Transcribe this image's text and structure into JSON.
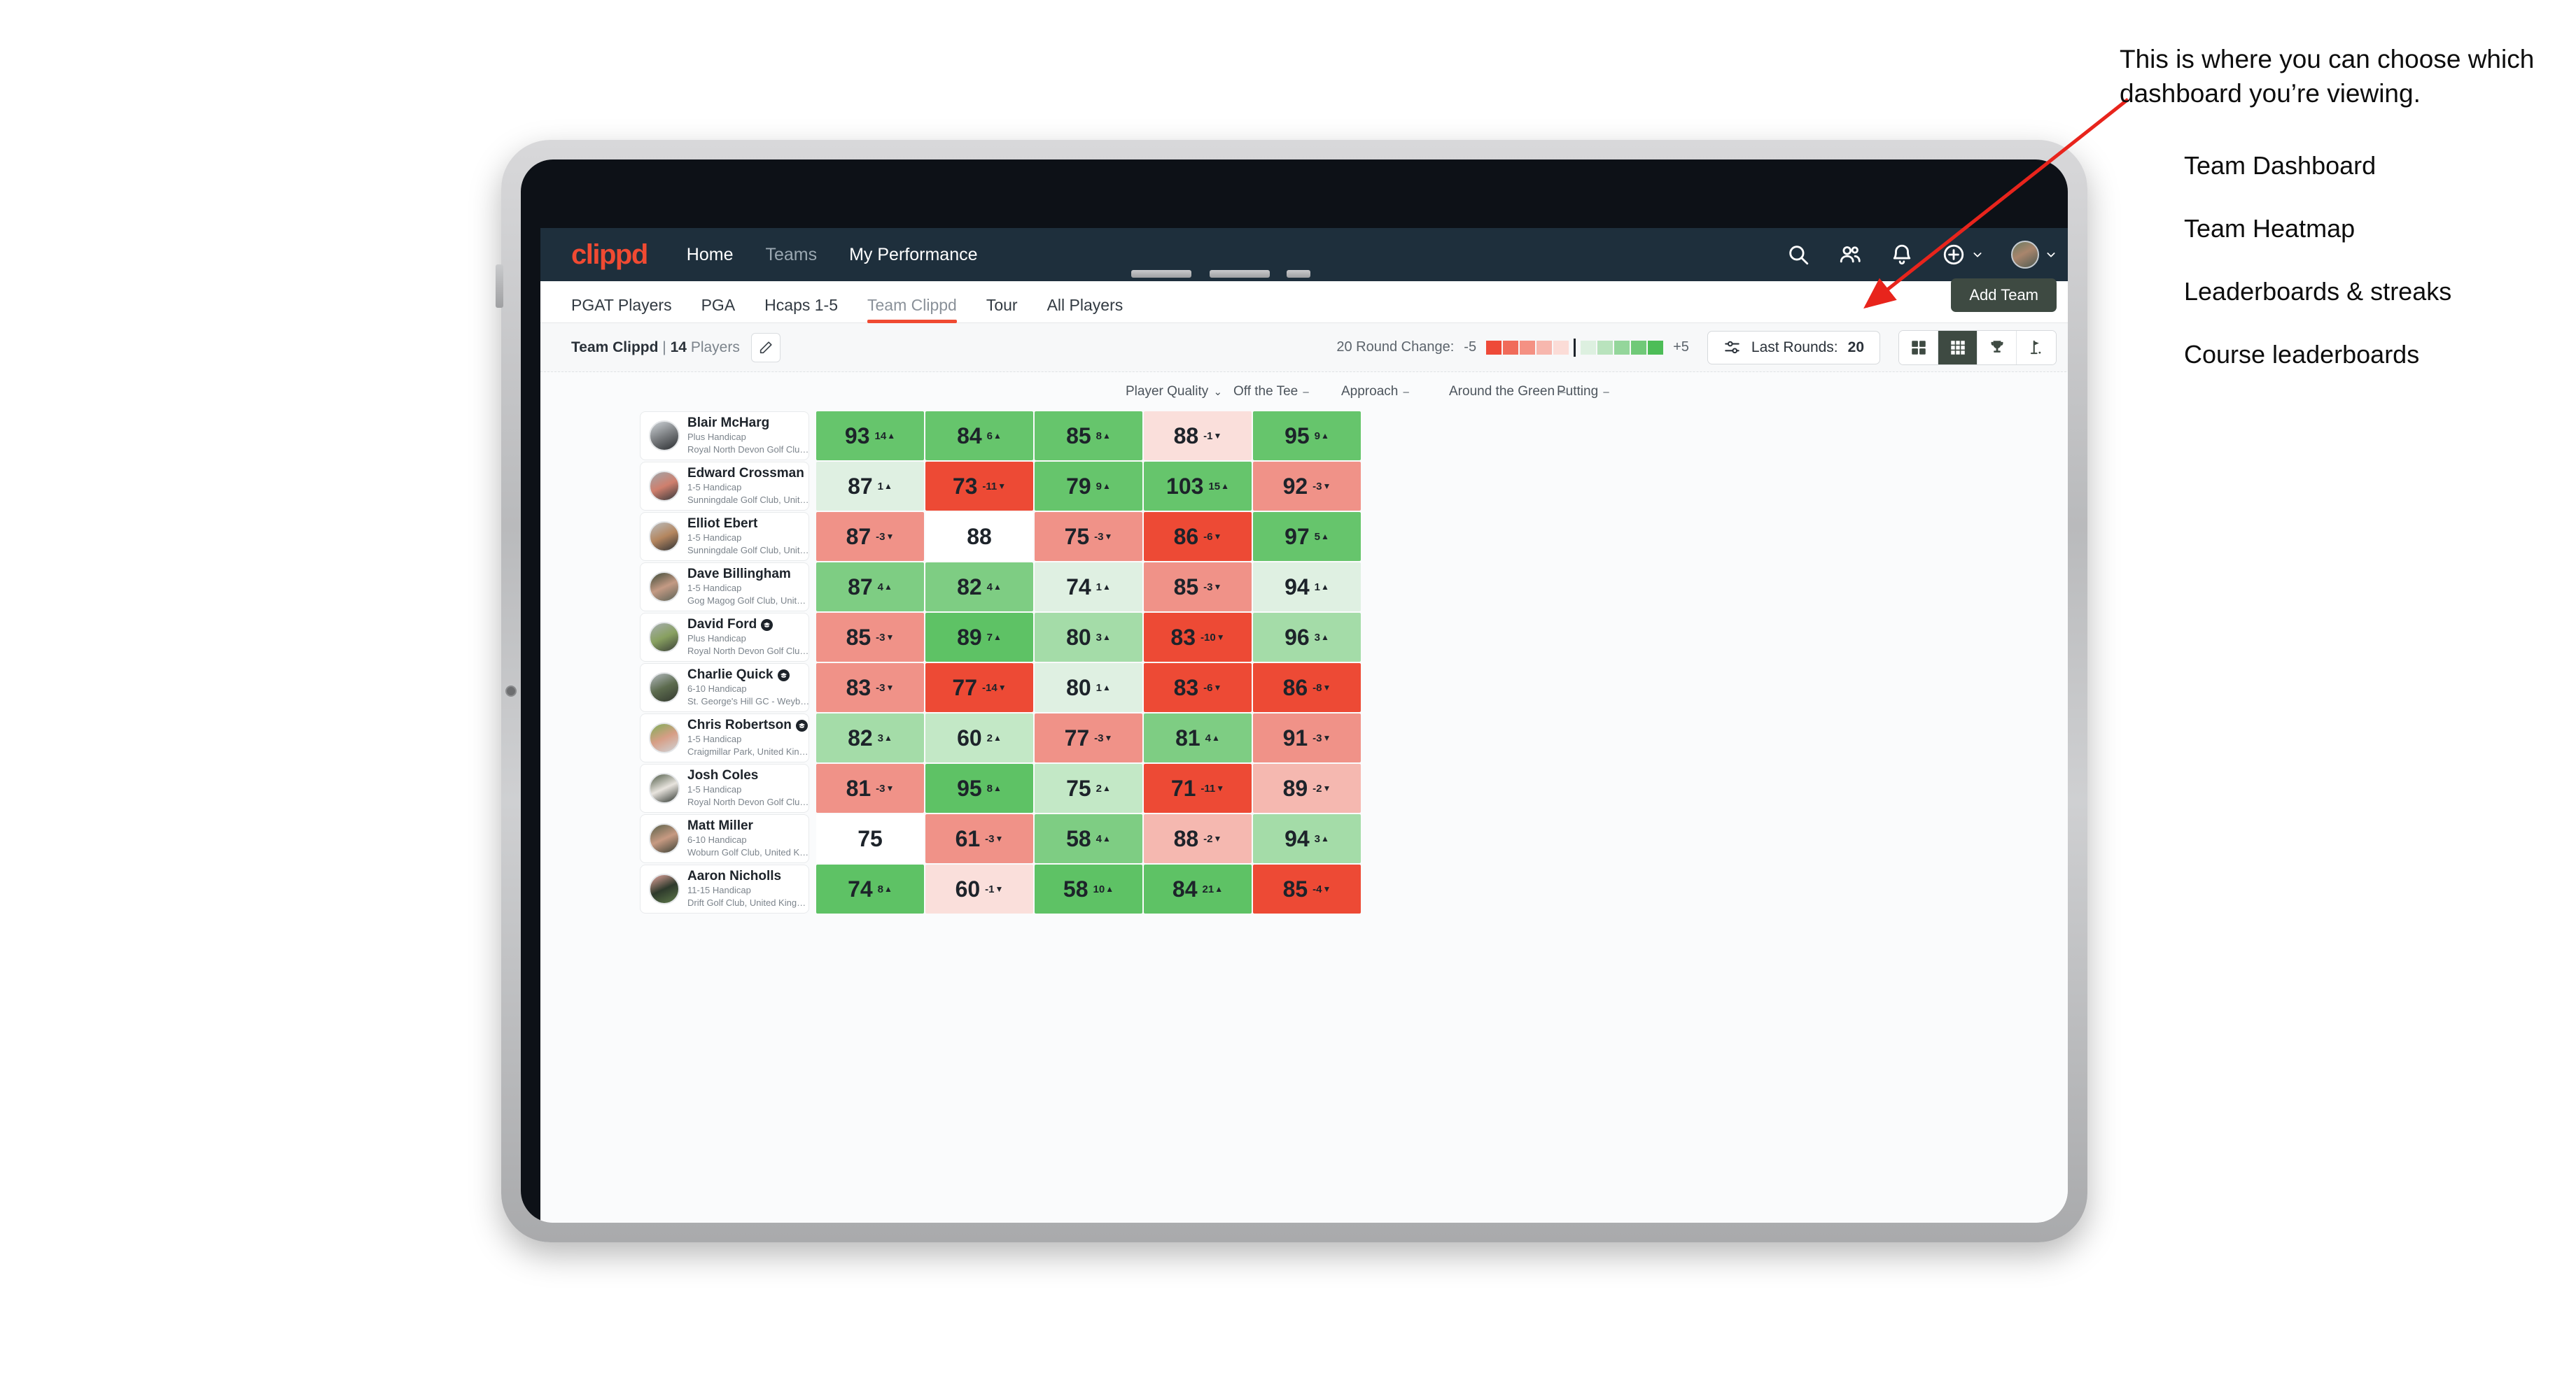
{
  "brand": {
    "logo_text": "clippd",
    "accent": "#f04a32",
    "navbar_bg": "#1e2f3c"
  },
  "topnav": {
    "links": [
      {
        "label": "Home",
        "dim": false
      },
      {
        "label": "Teams",
        "dim": true
      },
      {
        "label": "My Performance",
        "dim": false
      }
    ],
    "icons": [
      "search-icon",
      "people-icon",
      "bell-icon",
      "plus-circle-icon",
      "avatar"
    ]
  },
  "subtabs": {
    "items": [
      {
        "label": "PGAT Players",
        "active": false
      },
      {
        "label": "PGA",
        "active": false
      },
      {
        "label": "Hcaps 1-5",
        "active": false
      },
      {
        "label": "Team Clippd",
        "active": true
      },
      {
        "label": "Tour",
        "active": false
      },
      {
        "label": "All Players",
        "active": false
      }
    ],
    "add_team_label": "Add Team"
  },
  "toolbar": {
    "team_name": "Team Clippd",
    "separator": "|",
    "player_count": "14",
    "players_word": "Players",
    "edit_icon": "pencil-icon",
    "round_change_label": "20 Round Change:",
    "scale_min": "-5",
    "scale_max": "+5",
    "scale_colors": [
      "#ee4a38",
      "#f06b5a",
      "#f49183",
      "#f7b7ae",
      "#fbdcd7",
      "#ddf0e0",
      "#b9e3bd",
      "#94d69b",
      "#70c978",
      "#4dbd57"
    ],
    "last_rounds_label": "Last Rounds:",
    "last_rounds_value": "20",
    "views": [
      {
        "icon": "grid-4-icon",
        "name": "Team Dashboard",
        "active": false
      },
      {
        "icon": "grid-9-icon",
        "name": "Team Heatmap",
        "active": true
      },
      {
        "icon": "trophy-icon",
        "name": "Leaderboards & streaks",
        "active": false
      },
      {
        "icon": "golf-flag-icon",
        "name": "Course leaderboards",
        "active": false
      }
    ]
  },
  "table": {
    "columns": [
      {
        "label": "Player Quality",
        "marker": "⌄"
      },
      {
        "label": "Off the Tee",
        "marker": "–"
      },
      {
        "label": "Approach",
        "marker": "–"
      },
      {
        "label": "Around the Green",
        "marker": "–"
      },
      {
        "label": "Putting",
        "marker": "–"
      }
    ],
    "rows": [
      {
        "name": "Blair McHarg",
        "badge": false,
        "handicap": "Plus Handicap",
        "club": "Royal North Devon Golf Club, United Kingdom",
        "avatar_colors": [
          "#cfd4d8",
          "#7a7d80",
          "#2b2e31"
        ],
        "cells": [
          {
            "value": "93",
            "delta": "14",
            "dir": "up",
            "bg": "#66c56c"
          },
          {
            "value": "84",
            "delta": "6",
            "dir": "up",
            "bg": "#66c56c"
          },
          {
            "value": "85",
            "delta": "8",
            "dir": "up",
            "bg": "#66c56c"
          },
          {
            "value": "88",
            "delta": "-1",
            "dir": "down",
            "bg": "#fadfdb"
          },
          {
            "value": "95",
            "delta": "9",
            "dir": "up",
            "bg": "#66c56c"
          }
        ]
      },
      {
        "name": "Edward Crossman",
        "badge": false,
        "handicap": "1-5 Handicap",
        "club": "Sunningdale Golf Club, United Kingdom",
        "avatar_colors": [
          "#9fa6ab",
          "#cf7f6d",
          "#34383b"
        ],
        "cells": [
          {
            "value": "87",
            "delta": "1",
            "dir": "up",
            "bg": "#dff0e2"
          },
          {
            "value": "73",
            "delta": "-11",
            "dir": "down",
            "bg": "#ed4a35"
          },
          {
            "value": "79",
            "delta": "9",
            "dir": "up",
            "bg": "#66c56c"
          },
          {
            "value": "103",
            "delta": "15",
            "dir": "up",
            "bg": "#66c56c"
          },
          {
            "value": "92",
            "delta": "-3",
            "dir": "down",
            "bg": "#f09288"
          }
        ]
      },
      {
        "name": "Elliot Ebert",
        "badge": false,
        "handicap": "1-5 Handicap",
        "club": "Sunningdale Golf Club, United Kingdom",
        "avatar_colors": [
          "#b9bdc0",
          "#b4865f",
          "#2f3235"
        ],
        "cells": [
          {
            "value": "87",
            "delta": "-3",
            "dir": "down",
            "bg": "#f09288"
          },
          {
            "value": "88",
            "delta": "",
            "dir": "",
            "bg": "#ffffff"
          },
          {
            "value": "75",
            "delta": "-3",
            "dir": "down",
            "bg": "#f09288"
          },
          {
            "value": "86",
            "delta": "-6",
            "dir": "down",
            "bg": "#ed4a35"
          },
          {
            "value": "97",
            "delta": "5",
            "dir": "up",
            "bg": "#66c56c"
          }
        ]
      },
      {
        "name": "Dave Billingham",
        "badge": false,
        "handicap": "1-5 Handicap",
        "club": "Gog Magog Golf Club, United Kingdom",
        "avatar_colors": [
          "#3d4a38",
          "#c49a84",
          "#5a6256"
        ],
        "cells": [
          {
            "value": "87",
            "delta": "4",
            "dir": "up",
            "bg": "#7ecd83"
          },
          {
            "value": "82",
            "delta": "4",
            "dir": "up",
            "bg": "#7ecd83"
          },
          {
            "value": "74",
            "delta": "1",
            "dir": "up",
            "bg": "#dff0e2"
          },
          {
            "value": "85",
            "delta": "-3",
            "dir": "down",
            "bg": "#f09288"
          },
          {
            "value": "94",
            "delta": "1",
            "dir": "up",
            "bg": "#dff0e2"
          }
        ]
      },
      {
        "name": "David Ford",
        "badge": true,
        "handicap": "Plus Handicap",
        "club": "Royal North Devon Golf Club, United Kingdom",
        "avatar_colors": [
          "#a7aeb2",
          "#88a060",
          "#3a4038"
        ],
        "cells": [
          {
            "value": "85",
            "delta": "-3",
            "dir": "down",
            "bg": "#f09288"
          },
          {
            "value": "89",
            "delta": "7",
            "dir": "up",
            "bg": "#5ec265"
          },
          {
            "value": "80",
            "delta": "3",
            "dir": "up",
            "bg": "#a4dca8"
          },
          {
            "value": "83",
            "delta": "-10",
            "dir": "down",
            "bg": "#ed4a35"
          },
          {
            "value": "96",
            "delta": "3",
            "dir": "up",
            "bg": "#a4dca8"
          }
        ]
      },
      {
        "name": "Charlie Quick",
        "badge": true,
        "handicap": "6-10 Handicap",
        "club": "St. George's Hill GC - Weybridge - Surrey, Uni...",
        "avatar_colors": [
          "#b5bbc0",
          "#5c6b4e",
          "#33392f"
        ],
        "cells": [
          {
            "value": "83",
            "delta": "-3",
            "dir": "down",
            "bg": "#f09288"
          },
          {
            "value": "77",
            "delta": "-14",
            "dir": "down",
            "bg": "#ed4a35"
          },
          {
            "value": "80",
            "delta": "1",
            "dir": "up",
            "bg": "#dff0e2"
          },
          {
            "value": "83",
            "delta": "-6",
            "dir": "down",
            "bg": "#ed4a35"
          },
          {
            "value": "86",
            "delta": "-8",
            "dir": "down",
            "bg": "#ed4a35"
          }
        ]
      },
      {
        "name": "Chris Robertson",
        "badge": true,
        "handicap": "1-5 Handicap",
        "club": "Craigmillar Park, United Kingdom",
        "avatar_colors": [
          "#7fae57",
          "#d79e86",
          "#cfd4d8"
        ],
        "cells": [
          {
            "value": "82",
            "delta": "3",
            "dir": "up",
            "bg": "#a4dca8"
          },
          {
            "value": "60",
            "delta": "2",
            "dir": "up",
            "bg": "#c3e8c6"
          },
          {
            "value": "77",
            "delta": "-3",
            "dir": "down",
            "bg": "#f09288"
          },
          {
            "value": "81",
            "delta": "4",
            "dir": "up",
            "bg": "#7ecd83"
          },
          {
            "value": "91",
            "delta": "-3",
            "dir": "down",
            "bg": "#f09288"
          }
        ]
      },
      {
        "name": "Josh Coles",
        "badge": false,
        "handicap": "1-5 Handicap",
        "club": "Royal North Devon Golf Club, United Kingdom",
        "avatar_colors": [
          "#4e5a46",
          "#e8e4de",
          "#2f3630"
        ],
        "cells": [
          {
            "value": "81",
            "delta": "-3",
            "dir": "down",
            "bg": "#f09288"
          },
          {
            "value": "95",
            "delta": "8",
            "dir": "up",
            "bg": "#5ec265"
          },
          {
            "value": "75",
            "delta": "2",
            "dir": "up",
            "bg": "#c3e8c6"
          },
          {
            "value": "71",
            "delta": "-11",
            "dir": "down",
            "bg": "#ed4a35"
          },
          {
            "value": "89",
            "delta": "-2",
            "dir": "down",
            "bg": "#f5b8b0"
          }
        ]
      },
      {
        "name": "Matt Miller",
        "badge": false,
        "handicap": "6-10 Handicap",
        "club": "Woburn Golf Club, United Kingdom",
        "avatar_colors": [
          "#586049",
          "#c79a82",
          "#3b4236"
        ],
        "cells": [
          {
            "value": "75",
            "delta": "",
            "dir": "",
            "bg": "#ffffff"
          },
          {
            "value": "61",
            "delta": "-3",
            "dir": "down",
            "bg": "#f09288"
          },
          {
            "value": "58",
            "delta": "4",
            "dir": "up",
            "bg": "#7ecd83"
          },
          {
            "value": "88",
            "delta": "-2",
            "dir": "down",
            "bg": "#f5b8b0"
          },
          {
            "value": "94",
            "delta": "3",
            "dir": "up",
            "bg": "#a4dca8"
          }
        ]
      },
      {
        "name": "Aaron Nicholls",
        "badge": false,
        "handicap": "11-15 Handicap",
        "club": "Drift Golf Club, United Kingdom",
        "avatar_colors": [
          "#e8a8a0",
          "#2e3a2c",
          "#5f7a4a"
        ],
        "cells": [
          {
            "value": "74",
            "delta": "8",
            "dir": "up",
            "bg": "#5ec265"
          },
          {
            "value": "60",
            "delta": "-1",
            "dir": "down",
            "bg": "#fadfdb"
          },
          {
            "value": "58",
            "delta": "10",
            "dir": "up",
            "bg": "#5ec265"
          },
          {
            "value": "84",
            "delta": "21",
            "dir": "up",
            "bg": "#5ec265"
          },
          {
            "value": "85",
            "delta": "-4",
            "dir": "down",
            "bg": "#ed4a35"
          }
        ]
      }
    ]
  },
  "annotation": {
    "text": "This is where you can choose which dashboard you’re viewing.",
    "items": [
      "Team Dashboard",
      "Team Heatmap",
      "Leaderboards & streaks",
      "Course leaderboards"
    ],
    "arrow_color": "#e8241c"
  }
}
